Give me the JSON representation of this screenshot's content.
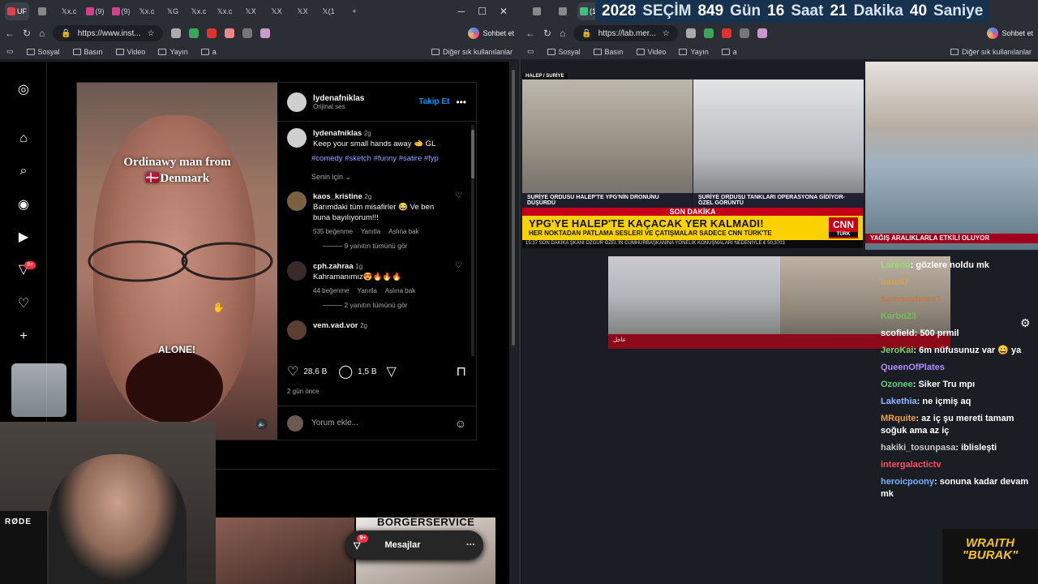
{
  "left_window": {
    "tabs": [
      {
        "label": "UF",
        "color": "#e04050"
      },
      {
        "label": "",
        "color": "#888"
      },
      {
        "label": "x.c",
        "color": "#fff"
      },
      {
        "label": "(9)",
        "color": "#d0408c"
      },
      {
        "label": "(9)",
        "color": "#d0408c"
      },
      {
        "label": "x.c",
        "color": "#fff"
      },
      {
        "label": "G",
        "color": "#fff"
      },
      {
        "label": "x.c",
        "color": "#fff"
      },
      {
        "label": "x.c",
        "color": "#fff"
      },
      {
        "label": "X",
        "color": "#fff"
      },
      {
        "label": "X",
        "color": "#fff"
      },
      {
        "label": "X",
        "color": "#fff"
      },
      {
        "label": "(1",
        "color": "#fff"
      }
    ],
    "url": "https://www.inst...",
    "chat_button": "Sohbet et",
    "bookmarks": [
      "Sosyal",
      "Basın",
      "Video",
      "Yayın",
      "a"
    ],
    "bookmarks_right": "Diğer sık kullanılanlar"
  },
  "right_window": {
    "tab_label": "(13)",
    "url": "https://lab.mer...",
    "chat_button": "Sohbet et",
    "bookmarks": [
      "Sosyal",
      "Basın",
      "Video",
      "Yayın",
      "a"
    ],
    "bookmarks_right": "Diğer sık kullanılanlar"
  },
  "instagram": {
    "sidebar_badge_reels": "9+",
    "post": {
      "username": "lydenafniklas",
      "audio": "Orijinal ses",
      "follow": "Takip Et",
      "video_caption": "Ordinawy man from 🇩🇰Denmark",
      "video_caption_line1": "Ordinawy man from",
      "video_caption_line2": "🇩🇰Denmark",
      "video_text": "ALONE!",
      "caption_user": "lydenafniklas",
      "caption_time": "2g",
      "caption_text": "Keep your small hands away 🫲 GL",
      "hashtags": "#comedy #sketch #funny #satire #fyp",
      "for_you": "Senin için",
      "comments": [
        {
          "user": "kaos_kristine",
          "time": "2g",
          "text": "Barımdaki tüm misafirler 😂 Ve ben buna bayılıyorum!!!",
          "likes": "535 beğenme",
          "reply": "Yanıtla",
          "translate": "Aslına bak",
          "view": "9 yanıtın tümünü gör"
        },
        {
          "user": "cph.zahraa",
          "time": "1g",
          "text": "Kahramanımız😍🔥🔥🔥",
          "likes": "44 beğenme",
          "reply": "Yanıtla",
          "translate": "Aslına bak",
          "view": "2 yanıtın tümünü gör"
        },
        {
          "user": "vem.vad.vor",
          "time": "2g",
          "text": "",
          "likes": "",
          "reply": "",
          "translate": "",
          "view": ""
        }
      ],
      "likes": "28,6 B",
      "comments_count": "1,5 B",
      "posted": "2 gün önce",
      "add_comment_placeholder": "Yorum ekle..."
    },
    "thumb_text": "BORGERSERVICE",
    "messages_label": "Mesajlar",
    "messages_badge": "9+"
  },
  "webcam": {
    "mic_brand": "RØDE"
  },
  "stream": {
    "countdown": [
      {
        "num": "2028",
        "unit": "SEÇİM"
      },
      {
        "num": "849",
        "unit": "Gün"
      },
      {
        "num": "16",
        "unit": "Saat"
      },
      {
        "num": "21",
        "unit": "Dakika"
      },
      {
        "num": "40",
        "unit": "Saniye"
      }
    ],
    "news": {
      "tag": "HALEP / SURİYE",
      "cap1": "SURİYE ORDUSU HALEP'TE YPG'NİN DRONUNU DÜŞÜRDÜ",
      "cap2": "SURİYE ORDUSU TANKLARI OPERASYONA GİDİYOR-ÖZEL GÖRÜNTÜ",
      "son_dakika": "SON DAKİKA",
      "headline": "YPG'YE HALEP'TE KAÇACAK YER KALMADI!",
      "subheadline": "HER NOKTADAN PATLAMA SESLERİ VE ÇATIŞMALAR SADECE CNN TÜRK'TE",
      "bottom": "15:37  SON DAKİKA  ŞKANI ÖZGÜR ÖZEL'İN CUMHURBAŞKANINA YÖNELİK KONUŞMALARI NEDENİYLE  € 50,3703",
      "channel": "CNN",
      "channel_sub": "TÜRK",
      "weather": "YAĞIŞ ARALIKLARLA ETKİLİ OLUYOR",
      "arabic_tag": "عاجل"
    },
    "chat": [
      {
        "user": "Larend",
        "text": "gözlere noldu mk",
        "color": "#8de36b"
      },
      {
        "user": "bate47",
        "text": "",
        "color": "#d1a54a"
      },
      {
        "user": "Semnusboss1",
        "text": "",
        "color": "#c07c4a"
      },
      {
        "user": "Karbo23",
        "text": "",
        "color": "#6fc15a"
      },
      {
        "user": "scofield",
        "text": "500 prmil",
        "color": "#ffffff"
      },
      {
        "user": "JeroKai",
        "text": "6m nüfusunuz var 😀 ya",
        "color": "#7fd16a"
      },
      {
        "user": "QueenOfPlates",
        "text": "",
        "color": "#b28bff"
      },
      {
        "user": "Ozonee",
        "text": "Siker Tru mpı",
        "color": "#5ad17a"
      },
      {
        "user": "Lakethia",
        "text": "ne içmiş aq",
        "color": "#8fb8ff"
      },
      {
        "user": "MRquite",
        "text": "az iç şu mereti tamam soğuk ama az iç",
        "color": "#f0a040"
      },
      {
        "user": "hakiki_tosunpasa",
        "text": "iblisleşti",
        "color": "#c8c8c8"
      },
      {
        "user": "intergalactictv",
        "text": "",
        "color": "#ff4d5e"
      },
      {
        "user": "heroicpoony",
        "text": "sonuna kadar devam mk",
        "color": "#7ab0ff"
      }
    ],
    "logo_line1": "WRAITH",
    "logo_line2": "\"BURAK\""
  }
}
